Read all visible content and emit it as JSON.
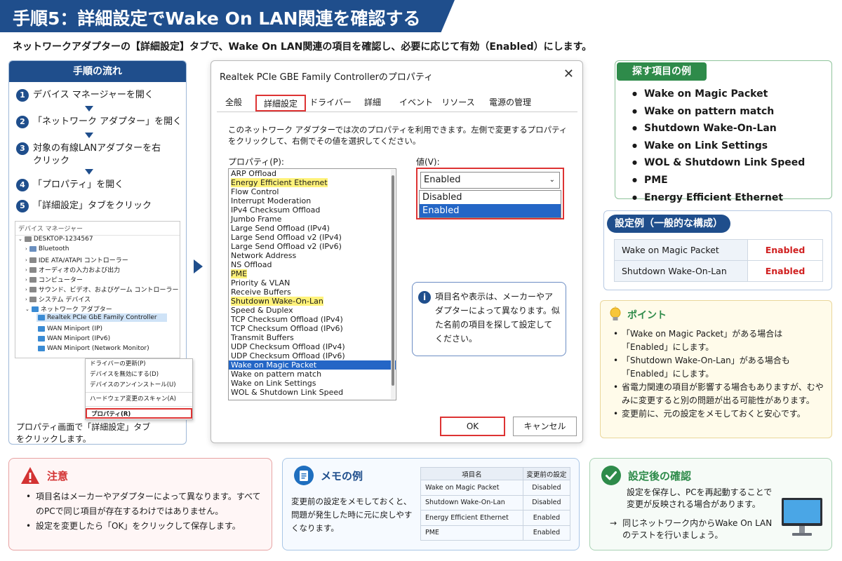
{
  "header": {
    "title": "手順5：詳細設定でWake On LAN関連を確認する",
    "subtitle": "ネットワークアダプターの【詳細設定】タブで、Wake On LAN関連の項目を確認し、必要に応じて有効（Enabled）にします。"
  },
  "steps": {
    "title": "手順の流れ",
    "items": [
      {
        "num": "1",
        "text": "デバイス マネージャーを開く"
      },
      {
        "num": "2",
        "text": "「ネットワーク アダプター」を開く"
      },
      {
        "num": "3",
        "text": "対象の有線LANアダプターを右クリック"
      },
      {
        "num": "4",
        "text": "「プロパティ」を開く"
      },
      {
        "num": "5",
        "text": "「詳細設定」タブをクリック"
      }
    ],
    "caption": "プロパティ画面で「詳細設定」タブをクリックします。"
  },
  "device_manager": {
    "title": "デバイス マネージャー",
    "tree": [
      {
        "label": "DESKTOP-1234567",
        "indent": 0
      },
      {
        "label": "Bluetooth",
        "indent": 1
      },
      {
        "label": "IDE ATA/ATAPI コントローラー",
        "indent": 1
      },
      {
        "label": "オーディオの入力および出力",
        "indent": 1
      },
      {
        "label": "コンピューター",
        "indent": 1
      },
      {
        "label": "サウンド、ビデオ、およびゲーム コントローラー",
        "indent": 1
      },
      {
        "label": "システム デバイス",
        "indent": 1
      },
      {
        "label": "ネットワーク アダプター",
        "indent": 1
      },
      {
        "label": "Realtek PCIe GbE Family Controller",
        "indent": 2
      },
      {
        "label": "WAN Miniport (IP)",
        "indent": 2
      },
      {
        "label": "WAN Miniport (IPv6)",
        "indent": 2
      },
      {
        "label": "WAN Miniport (Network Monitor)",
        "indent": 2
      }
    ],
    "context_menu": [
      "ドライバーの更新(P)",
      "デバイスを無効にする(D)",
      "デバイスのアンインストール(U)",
      "ハードウェア変更のスキャン(A)",
      "プロパティ(R)"
    ]
  },
  "dialog": {
    "title": "Realtek PCIe GBE Family Controllerのプロパティ",
    "close": "✕",
    "tabs": [
      "全般",
      "詳細設定",
      "ドライバー",
      "詳細",
      "イベント",
      "リソース",
      "電源の管理"
    ],
    "active_tab": "詳細設定",
    "description": "このネットワーク アダプターでは次のプロパティを利用できます。左側で変更するプロパティをクリックして、右側でその値を選択してください。",
    "property_label": "プロパティ(P):",
    "value_label": "値(V):",
    "properties": [
      {
        "name": "ARP Offload",
        "state": ""
      },
      {
        "name": "Energy Efficient Ethernet",
        "state": "highlight"
      },
      {
        "name": "Flow Control",
        "state": ""
      },
      {
        "name": "Interrupt Moderation",
        "state": ""
      },
      {
        "name": "IPv4 Checksum Offload",
        "state": ""
      },
      {
        "name": "Jumbo Frame",
        "state": ""
      },
      {
        "name": "Large Send Offload (IPv4)",
        "state": ""
      },
      {
        "name": "Large Send Offload v2 (IPv4)",
        "state": ""
      },
      {
        "name": "Large Send Offload v2 (IPv6)",
        "state": ""
      },
      {
        "name": "Network Address",
        "state": ""
      },
      {
        "name": "NS Offload",
        "state": ""
      },
      {
        "name": "PME",
        "state": "highlight"
      },
      {
        "name": "Priority & VLAN",
        "state": ""
      },
      {
        "name": "Receive Buffers",
        "state": ""
      },
      {
        "name": "Shutdown Wake-On-Lan",
        "state": "highlight"
      },
      {
        "name": "Speed & Duplex",
        "state": ""
      },
      {
        "name": "TCP Checksum Offload (IPv4)",
        "state": ""
      },
      {
        "name": "TCP Checksum Offload (IPv6)",
        "state": ""
      },
      {
        "name": "Transmit Buffers",
        "state": ""
      },
      {
        "name": "UDP Checksum Offload (IPv4)",
        "state": ""
      },
      {
        "name": "UDP Checksum Offload (IPv6)",
        "state": ""
      },
      {
        "name": "Wake on Magic Packet",
        "state": "selected"
      },
      {
        "name": "Wake on pattern match",
        "state": ""
      },
      {
        "name": "Wake on Link Settings",
        "state": ""
      },
      {
        "name": "WOL & Shutdown Link Speed",
        "state": ""
      }
    ],
    "value_selected": "Enabled",
    "value_options": [
      {
        "label": "Disabled",
        "selected": false
      },
      {
        "label": "Enabled",
        "selected": true
      }
    ],
    "note": "項目名や表示は、メーカーやアダプターによって異なります。似た名前の項目を探して設定してください。",
    "ok": "OK",
    "cancel": "キャンセル"
  },
  "find_items": {
    "title": "探す項目の例",
    "items": [
      "Wake on Magic Packet",
      "Wake on pattern match",
      "Shutdown Wake-On-Lan",
      "Wake on Link Settings",
      "WOL & Shutdown Link Speed",
      "PME",
      "Energy Efficient Ethernet"
    ]
  },
  "config_example": {
    "title": "設定例（一般的な構成）",
    "rows": [
      {
        "item": "Wake on Magic Packet",
        "value": "Enabled"
      },
      {
        "item": "Shutdown Wake-On-Lan",
        "value": "Enabled"
      }
    ]
  },
  "points": {
    "title": "ポイント",
    "items": [
      "「Wake on Magic Packet」がある場合は「Enabled」にします。",
      "「Shutdown Wake-On-Lan」がある場合も「Enabled」にします。",
      "省電力関連の項目が影響する場合もありますが、むやみに変更すると別の問題が出る可能性があります。",
      "変更前に、元の設定をメモしておくと安心です。"
    ]
  },
  "caution": {
    "title": "注意",
    "items": [
      "項目名はメーカーやアダプターによって異なります。すべてのPCで同じ項目が存在するわけではありません。",
      "設定を変更したら「OK」をクリックして保存します。"
    ]
  },
  "memo": {
    "title": "メモの例",
    "description": "変更前の設定をメモしておくと、問題が発生した時に元に戻しやすくなります。",
    "table_headers": [
      "項目名",
      "変更前の設定"
    ],
    "table_rows": [
      [
        "Wake on Magic Packet",
        "Disabled"
      ],
      [
        "Shutdown Wake-On-Lan",
        "Disabled"
      ],
      [
        "Energy Efficient Ethernet",
        "Enabled"
      ],
      [
        "PME",
        "Enabled"
      ]
    ]
  },
  "after": {
    "title": "設定後の確認",
    "description": "設定を保存し、PCを再起動することで変更が反映される場合があります。",
    "arrow": "→",
    "next": "同じネットワーク内からWake On LANのテストを行いましょう。"
  },
  "colors": {
    "primary": "#1f4e8c",
    "green": "#2e8b4a",
    "red": "#d33333",
    "highlight": "#fff27a",
    "selected": "#2466c6"
  }
}
